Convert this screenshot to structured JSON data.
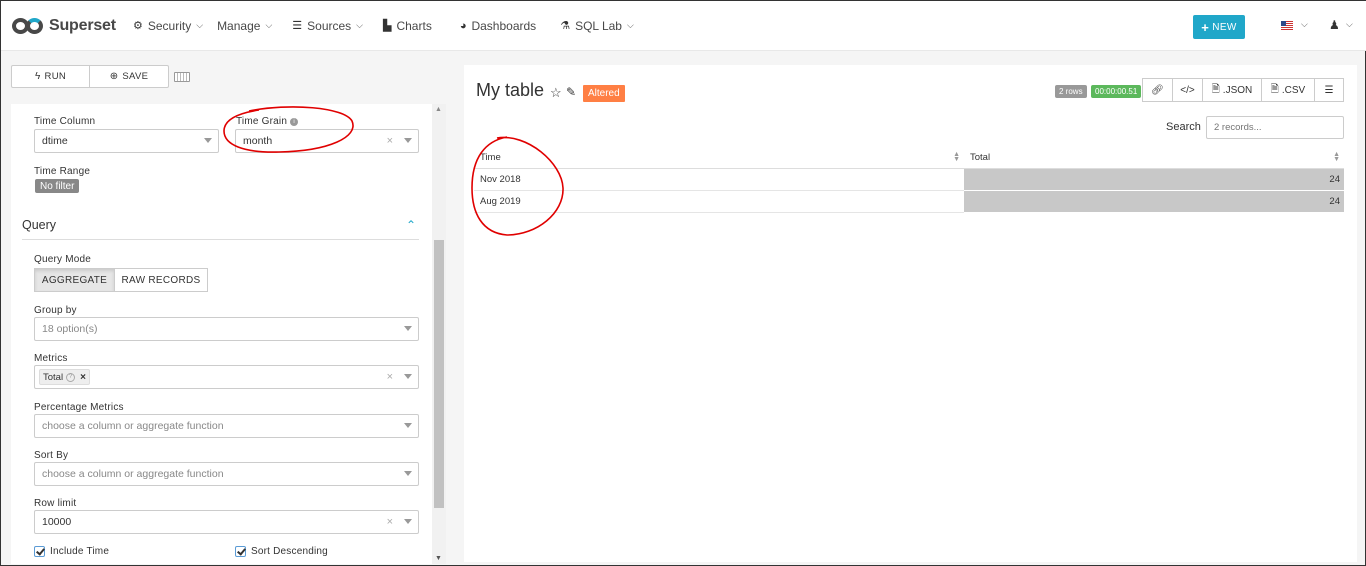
{
  "brand": {
    "name": "Superset"
  },
  "nav": {
    "items": [
      {
        "label": "Security",
        "icon": "gears-icon",
        "caret": true
      },
      {
        "label": "Manage",
        "icon": "",
        "caret": true
      },
      {
        "label": "Sources",
        "icon": "database-icon",
        "caret": true
      },
      {
        "label": "Charts",
        "icon": "bar-chart-icon",
        "caret": false
      },
      {
        "label": "Dashboards",
        "icon": "dashboard-icon",
        "caret": false
      },
      {
        "label": "SQL Lab",
        "icon": "flask-icon",
        "caret": true
      }
    ],
    "new_label": "NEW"
  },
  "actions": {
    "run_label": "RUN",
    "save_label": "SAVE"
  },
  "controls": {
    "time_column": {
      "label": "Time Column",
      "value": "dtime"
    },
    "time_grain": {
      "label": "Time Grain",
      "value": "month"
    },
    "time_range": {
      "label": "Time Range",
      "value": "No filter"
    },
    "query_section": "Query",
    "query_mode": {
      "label": "Query Mode",
      "options": [
        "AGGREGATE",
        "RAW RECORDS"
      ],
      "selected": "AGGREGATE"
    },
    "group_by": {
      "label": "Group by",
      "value": "18 option(s)"
    },
    "metrics": {
      "label": "Metrics",
      "tag": "Total"
    },
    "percentage_metrics": {
      "label": "Percentage Metrics",
      "placeholder": "choose a column or aggregate function"
    },
    "sort_by": {
      "label": "Sort By",
      "placeholder": "choose a column or aggregate function"
    },
    "row_limit": {
      "label": "Row limit",
      "value": "10000"
    },
    "include_time": {
      "label": "Include Time",
      "checked": true
    },
    "sort_descending": {
      "label": "Sort Descending",
      "checked": true
    }
  },
  "chart": {
    "title": "My table",
    "altered_label": "Altered",
    "rows_badge": "2 rows",
    "time_badge": "00:00:00.51",
    "buttons": {
      "json": ".JSON",
      "csv": ".CSV"
    },
    "search_label": "Search",
    "search_placeholder": "2 records...",
    "table": {
      "columns": [
        "Time",
        "Total"
      ],
      "rows": [
        {
          "time": "Nov 2018",
          "total": "24"
        },
        {
          "time": "Aug 2019",
          "total": "24"
        }
      ]
    }
  },
  "colors": {
    "accent": "#20a7c9",
    "altered": "#ff7f44",
    "success": "#5cb85c",
    "annotation": "#e00000"
  }
}
